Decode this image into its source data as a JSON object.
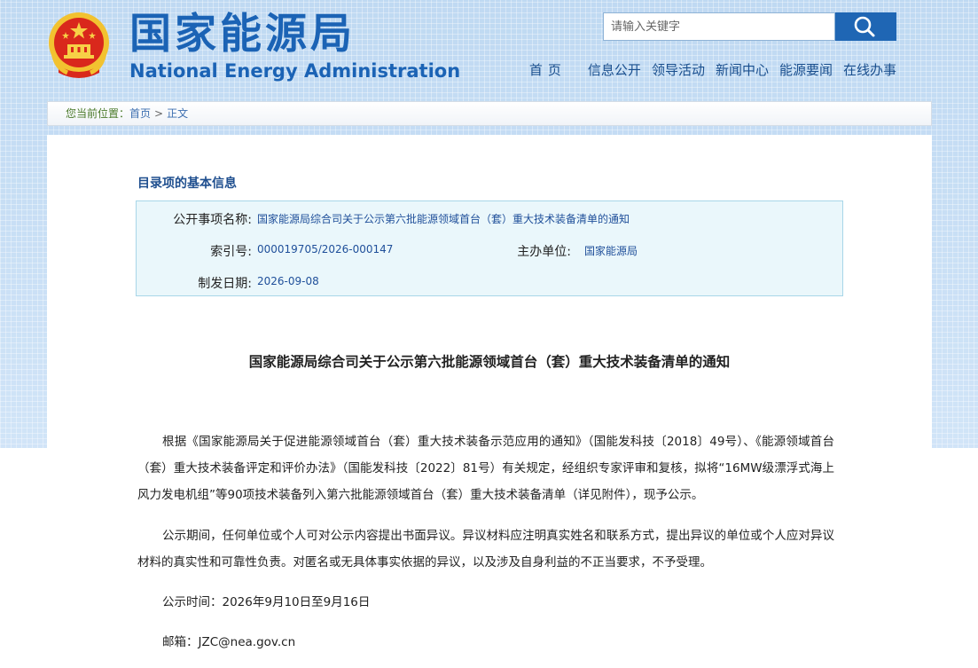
{
  "header": {
    "logo_cn": "国家能源局",
    "logo_en": "National Energy Administration",
    "search_placeholder": "请输入关键字",
    "nav": [
      "首页",
      "信息公开",
      "领导活动",
      "新闻中心",
      "能源要闻",
      "在线办事"
    ]
  },
  "breadcrumb": {
    "prefix": "您当前位置：",
    "home": "首页",
    "sep": ">",
    "current": "正文"
  },
  "catalog": {
    "section_title": "目录项的基本信息",
    "subject_label": "公开事项名称:",
    "subject_value": "国家能源局综合司关于公示第六批能源领域首台（套）重大技术装备清单的通知",
    "index_label": "索引号:",
    "index_value": "000019705/2026-000147",
    "org_label": "主办单位:",
    "org_value": "国家能源局",
    "date_label": "制发日期:",
    "date_value": "2026-09-08"
  },
  "article": {
    "title": "国家能源局综合司关于公示第六批能源领域首台（套）重大技术装备清单的通知",
    "p1": "根据《国家能源局关于促进能源领域首台（套）重大技术装备示范应用的通知》（国能发科技〔2018〕49号）、《能源领域首台（套）重大技术装备评定和评价办法》（国能发科技〔2022〕81号）有关规定，经组织专家评审和复核，拟将“16MW级漂浮式海上风力发电机组”等90项技术装备列入第六批能源领域首台（套）重大技术装备清单（详见附件），现予公示。",
    "p2": "公示期间，任何单位或个人可对公示内容提出书面异议。异议材料应注明真实姓名和联系方式，提出异议的单位或个人应对异议材料的真实性和可靠性负责。对匿名或无具体事实依据的异议，以及涉及自身利益的不正当要求，不予受理。",
    "p3": "公示时间：2026年9月10日至9月16日",
    "p4": "邮箱：JZC@nea.gov.cn"
  },
  "colors": {
    "brand_blue": "#1b63b5",
    "search_button": "#1f66b4",
    "info_bg": "#eaf7fb"
  },
  "icons": {
    "emblem": "national-emblem-icon",
    "search": "magnifier-icon"
  }
}
